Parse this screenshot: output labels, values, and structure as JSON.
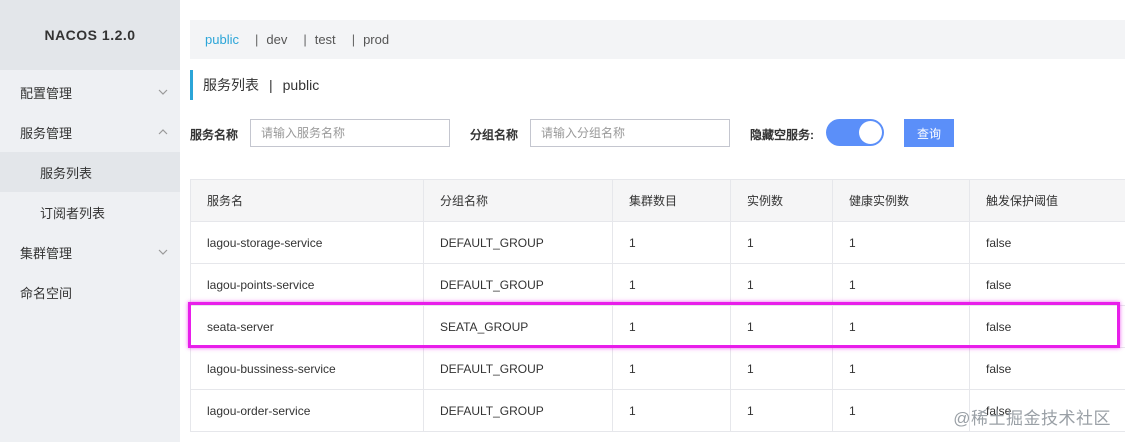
{
  "sidebar": {
    "brand": "NACOS 1.2.0",
    "items": [
      {
        "label": "配置管理"
      },
      {
        "label": "服务管理"
      },
      {
        "label": "服务列表"
      },
      {
        "label": "订阅者列表"
      },
      {
        "label": "集群管理"
      },
      {
        "label": "命名空间"
      }
    ]
  },
  "namespaces": [
    "public",
    "dev",
    "test",
    "prod"
  ],
  "namespace_separator": "|",
  "page_title": {
    "main": "服务列表",
    "separator": "|",
    "namespace": "public"
  },
  "filters": {
    "service_name_label": "服务名称",
    "service_name_placeholder": "请输入服务名称",
    "group_name_label": "分组名称",
    "group_name_placeholder": "请输入分组名称",
    "hide_empty_label": "隐藏空服务:",
    "hide_empty_on": true,
    "query_button": "查询"
  },
  "table": {
    "headers": [
      "服务名",
      "分组名称",
      "集群数目",
      "实例数",
      "健康实例数",
      "触发保护阈值"
    ],
    "rows": [
      [
        "lagou-storage-service",
        "DEFAULT_GROUP",
        "1",
        "1",
        "1",
        "false"
      ],
      [
        "lagou-points-service",
        "DEFAULT_GROUP",
        "1",
        "1",
        "1",
        "false"
      ],
      [
        "seata-server",
        "SEATA_GROUP",
        "1",
        "1",
        "1",
        "false"
      ],
      [
        "lagou-bussiness-service",
        "DEFAULT_GROUP",
        "1",
        "1",
        "1",
        "false"
      ],
      [
        "lagou-order-service",
        "DEFAULT_GROUP",
        "1",
        "1",
        "1",
        "false"
      ]
    ]
  },
  "watermark": "@稀土掘金技术社区",
  "colors": {
    "accent": "#2ba5d8",
    "primary": "#5b8ff9",
    "highlight": "#e81eea"
  },
  "icons": {
    "collapsed": "chevron-down-icon",
    "expanded": "chevron-up-icon"
  }
}
